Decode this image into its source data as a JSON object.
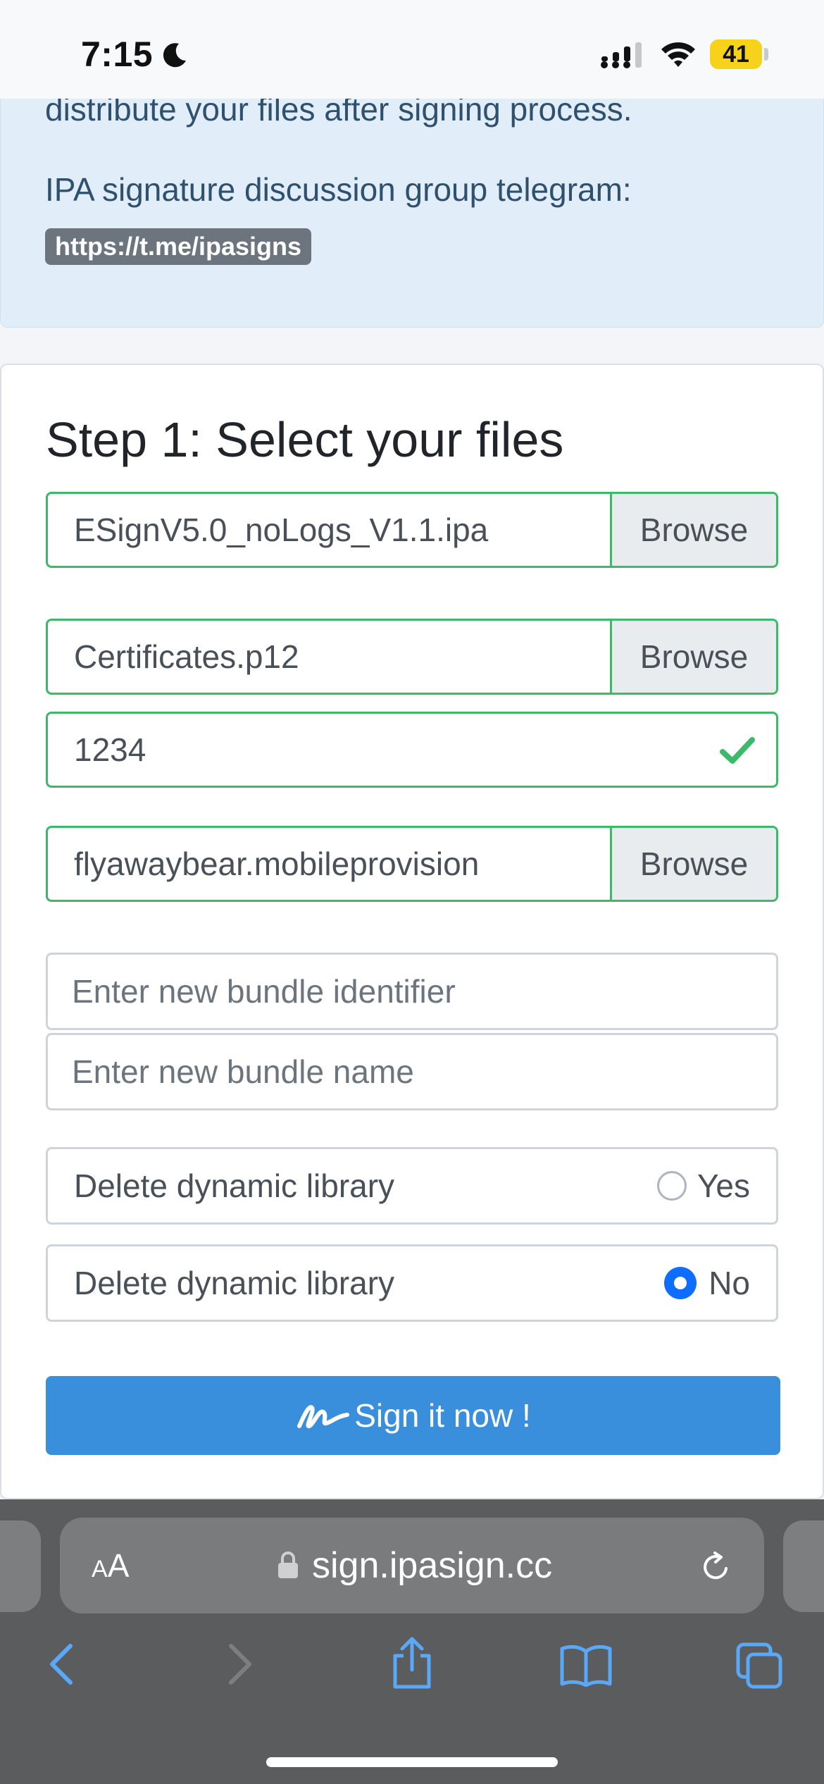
{
  "status_bar": {
    "time": "7:15",
    "battery_level": "41",
    "icons": [
      "moon-icon",
      "signal-icon",
      "wifi-icon",
      "battery-icon"
    ]
  },
  "info": {
    "cut_text": "distribute your files after signing process.",
    "group_text": "IPA signature discussion group telegram:",
    "telegram_link": "https://t.me/ipasigns"
  },
  "step1": {
    "title": "Step 1: Select your files",
    "ipa_file": "ESignV5.0_noLogs_V1.1.ipa",
    "p12_file": "Certificates.p12",
    "password": "1234",
    "provision_file": "flyawaybear.mobileprovision",
    "browse_label": "Browse",
    "bundle_id_placeholder": "Enter new bundle identifier",
    "bundle_name_placeholder": "Enter new bundle name",
    "delete_lib_label": "Delete dynamic library",
    "yes_label": "Yes",
    "no_label": "No",
    "selected_option": "No",
    "sign_button": "Sign it now !"
  },
  "browser": {
    "aa_small": "A",
    "aa_large": "A",
    "url": "sign.ipasign.cc",
    "icons": [
      "back-icon",
      "forward-icon",
      "share-icon",
      "bookmarks-icon",
      "tabs-icon"
    ]
  },
  "colors": {
    "valid_border": "#3cba6a",
    "button_blue": "#3a8fdd",
    "radio_blue": "#0d6efd",
    "info_bg": "#e1eefa",
    "safari_blue": "#5aa9f8"
  }
}
